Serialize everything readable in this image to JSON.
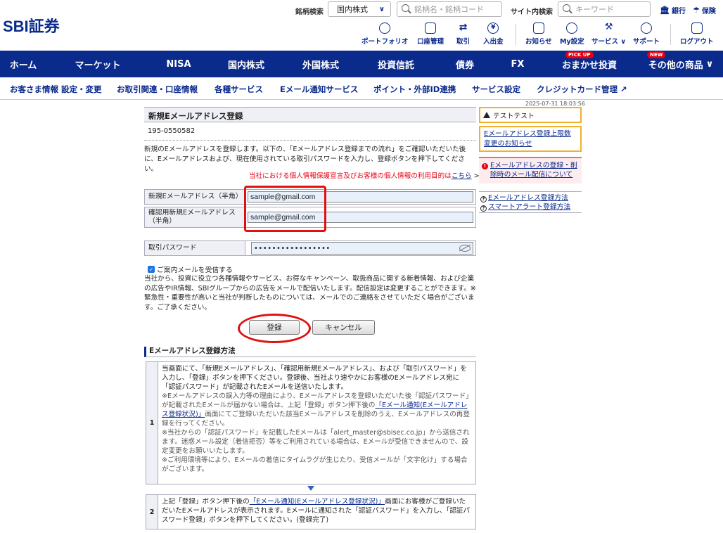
{
  "header": {
    "logo": "SBI証券",
    "stock_search_label": "銘柄検索",
    "market_select": "国内株式",
    "stock_search_placeholder": "銘柄名・銘柄コード",
    "site_search_label": "サイト内検索",
    "site_search_placeholder": "キーワード",
    "bank_link": "銀行",
    "insurance_link": "保険",
    "icons": [
      {
        "label": "ポートフォリオ",
        "icon": "portfolio-icon"
      },
      {
        "label": "口座管理",
        "icon": "account-icon"
      },
      {
        "label": "取引",
        "icon": "trade-icon"
      },
      {
        "label": "入出金",
        "icon": "yen-icon"
      },
      {
        "label": "お知らせ",
        "icon": "message-icon"
      },
      {
        "label": "My設定",
        "icon": "user-icon"
      },
      {
        "label": "サービス",
        "icon": "service-icon"
      },
      {
        "label": "サポート",
        "icon": "headset-icon"
      },
      {
        "label": "ログアウト",
        "icon": "logout-icon"
      }
    ]
  },
  "mainnav": [
    {
      "label": "ホーム"
    },
    {
      "label": "マーケット"
    },
    {
      "label": "NISA"
    },
    {
      "label": "国内株式"
    },
    {
      "label": "外国株式"
    },
    {
      "label": "投資信託"
    },
    {
      "label": "債券"
    },
    {
      "label": "FX"
    },
    {
      "label": "おまかせ投資",
      "badge": "PICK UP"
    },
    {
      "label": "その他の商品",
      "badge": "NEW"
    }
  ],
  "subnav": [
    "お客さま情報 設定・変更",
    "お取引関連・口座情報",
    "各種サービス",
    "Eメール通知サービス",
    "ポイント・外部ID連携",
    "サービス設定",
    "クレジットカード管理"
  ],
  "timestamp": "2025-07-31 18:03:56",
  "form": {
    "title": "新規Eメールアドレス登録",
    "account_number": "195-0550582",
    "intro": "新規のEメールアドレスを登録します。以下の、「Eメールアドレス登録までの流れ」をご確認いただいた後に、Eメールアドレスおよび、現在使用されている取引パスワードを入力し、登録ボタンを押下してください。",
    "privacy_text": "当社における個人情報保護宣言及びお客様の個人情報の利用目的は",
    "privacy_link": "こちら",
    "privacy_arrow": ">",
    "email_label": "新規Eメールアドレス（半角）",
    "email_value": "sample@gmail.com",
    "confirm_label": "確認用新規Eメールアドレス（半角）",
    "confirm_value": "sample@gmail.com",
    "password_label": "取引パスワード",
    "password_value": "•••••••••••••••••",
    "checkbox_label": "ご案内メールを受信する",
    "checkbox_mark": "✓",
    "notice": "当社から、投資に役立つ各種情報やサービス、お得なキャンペーン、取扱商品に関する新着情報、および企業の広告やIR情報、SBIグループからの広告をメールで配信いたします。配信設定は変更することができます。※緊急性・重要性が高いと当社が判断したものについては、メールでのご連絡をさせていただく場合がございます。ご了承ください。",
    "register_button": "登録",
    "cancel_button": "キャンセル"
  },
  "steps": {
    "title": "Eメールアドレス登録方法",
    "step1": {
      "num": "1",
      "main": "当画面にて、「新規Eメールアドレス」、「確認用新規Eメールアドレス」、および「取引パスワード」を入力し、「登録」ボタンを押下ください。登録後、当社より速やかにお客様のEメールアドレス宛に「認証パスワード」が記載されたEメールを送信いたします。",
      "note1a": "※Eメールアドレスの誤入力等の理由により、Eメールアドレスを登録いただいた後「認証パスワード」が記載されたEメールが届かない場合は、上記「登録」ボタン押下後の",
      "note1_link": "「Eメール通知(Eメールアドレス登録状況)」",
      "note1b": "画面にてご登録いただいた該当Eメールアドレスを削除のうえ、Eメールアドレスの再登録を行ってください。",
      "note2": "※当社からの「認証パスワード」を記載したEメールは「alert_master@sbisec.co.jp」から送信されます。迷惑メール設定（着信拒否）等をご利用されている場合は、Eメールが受信できませんので、設定変更をお願いいたします。",
      "note3": "※ご利用環境等により、Eメールの着信にタイムラグが生じたり、受信メールが「文字化け」する場合がございます。"
    },
    "step2": {
      "num": "2",
      "a": "上記「登録」ボタン押下後の",
      "link": "「Eメール通知(Eメールアドレス登録状況)」",
      "b": "画面にお客様がご登録いただいたEメールアドレスが表示されます。Eメールに通知された「認証パスワード」を入力し、「認証パスワード登録」ボタンを押下してください。(登録完了)"
    }
  },
  "sidebar": {
    "testtest": "テストテスト",
    "limit_notice": "Eメールアドレス登録上限数変更のお知らせ",
    "delivery_notice": "Eメールアドレスの登録・削除時のメール配信について",
    "links": [
      "Eメールアドレス登録方法",
      "スマートアラート登録方法"
    ]
  },
  "colors": {
    "brand": "#0a2a8c",
    "highlight": "#e01010",
    "warning_border": "#f0b030"
  }
}
